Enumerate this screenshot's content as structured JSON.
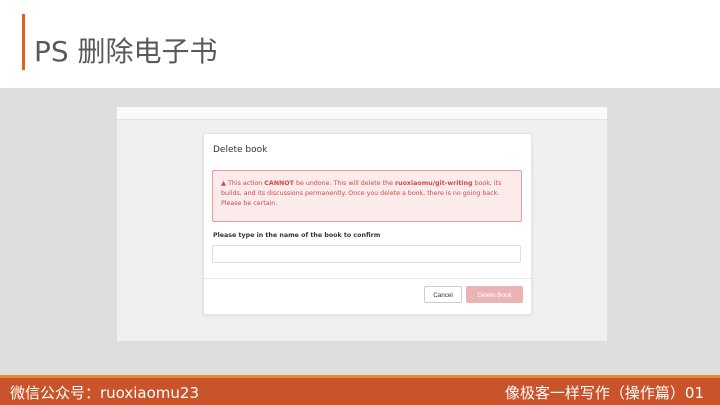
{
  "slide": {
    "title": "PS 删除电子书",
    "footer_left": "微信公众号：ruoxiaomu23",
    "footer_right": "像极客一样写作（操作篇）01"
  },
  "modal": {
    "title": "Delete book",
    "warning": {
      "icon": "warning-triangle-icon",
      "prefix": "This action ",
      "emphasis": "CANNOT",
      "middle": " be undone. This will delete the ",
      "repo": "ruoxiaomu/git-writing",
      "suffix": " book, its builds, and its discussions permanently. Once you delete a book, there is no going back. Please be certain."
    },
    "confirm_label": "Please type in the name of the book to confirm",
    "confirm_value": "",
    "cancel_label": "Cancel",
    "delete_label": "Delete Book"
  },
  "colors": {
    "accent": "#e0631a",
    "footer_bg": "#c9532a",
    "warning_text": "#cc4b4b",
    "delete_button_disabled": "#ebb3b3"
  }
}
